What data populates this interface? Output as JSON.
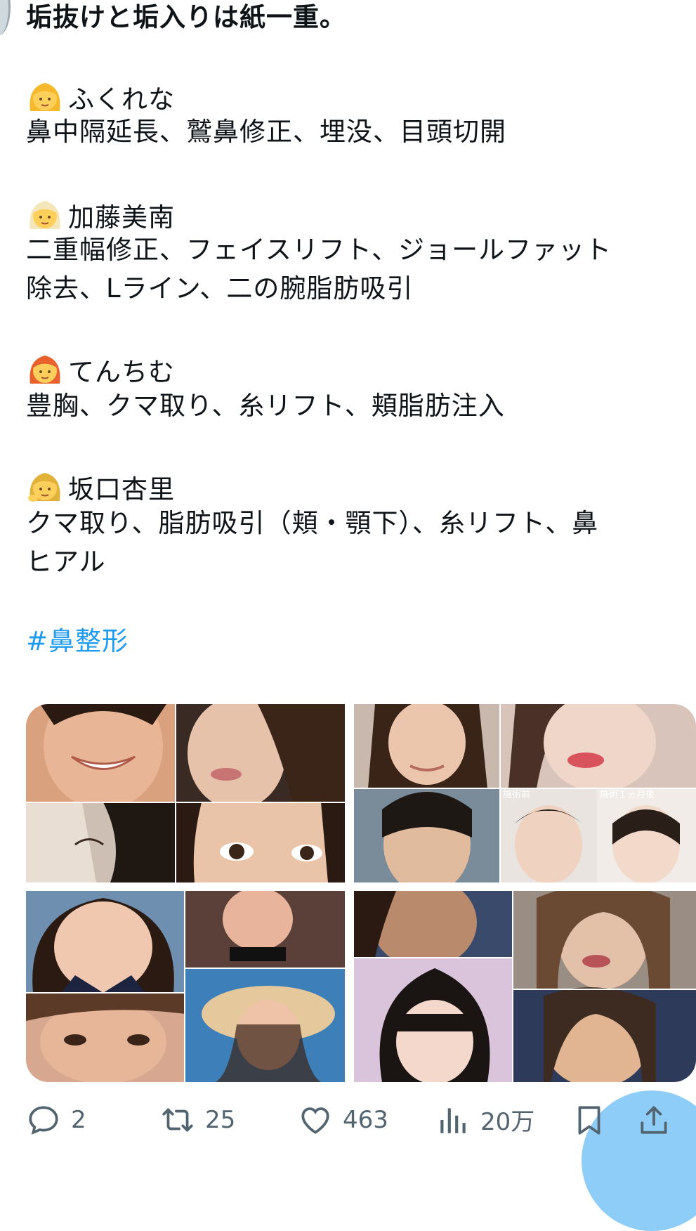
{
  "tweet": {
    "headline": "垢抜けと垢入りは紙一重。",
    "sections": [
      {
        "name": "ふくれな",
        "line1": "鼻中隔延長、鷲鼻修正、埋没、目頭切開",
        "line2": ""
      },
      {
        "name": "加藤美南",
        "line1": "二重幅修正、フェイスリフト、ジョールファット",
        "line2": "除去、Lライン、二の腕脂肪吸引"
      },
      {
        "name": "てんちむ",
        "line1": "豊胸、クマ取り、糸リフト、頬脂肪注入",
        "line2": ""
      },
      {
        "name": "坂口杏里",
        "line1": "クマ取り、脂肪吸引（頬・顎下）、糸リフト、鼻",
        "line2": "ヒアル"
      }
    ],
    "hashtag": "#鼻整形",
    "media_captions": {
      "before": "施術前",
      "after": "施術１ヵ月後"
    }
  },
  "actions": {
    "reply_count": "2",
    "retweet_count": "25",
    "like_count": "463",
    "view_count": "20万"
  },
  "icons": {
    "reply": "speech-bubble-icon",
    "retweet": "retweet-icon",
    "like": "heart-icon",
    "views": "bar-chart-icon",
    "bookmark": "bookmark-icon",
    "share": "share-icon"
  },
  "colors": {
    "text": "#0f1419",
    "secondary": "#536471",
    "link": "#1d9bf0",
    "fab": "#8ecdf8"
  }
}
